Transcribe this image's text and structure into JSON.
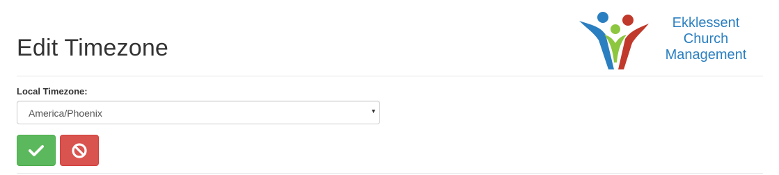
{
  "header": {
    "title": "Edit Timezone",
    "logo": {
      "lines": [
        "Ekklessent",
        "Church",
        "Management"
      ],
      "icon": "people-figures-logo"
    }
  },
  "form": {
    "timezone_label": "Local Timezone:",
    "timezone_value": "America/Phoenix",
    "caret_glyph": "▾"
  },
  "actions": {
    "save_icon": "checkmark-icon",
    "cancel_icon": "ban-icon"
  },
  "colors": {
    "save": "#5cb85c",
    "cancel": "#d9534f",
    "logo_blue": "#2a7fc0",
    "logo_red": "#c0392b",
    "logo_green": "#8dc63f"
  }
}
